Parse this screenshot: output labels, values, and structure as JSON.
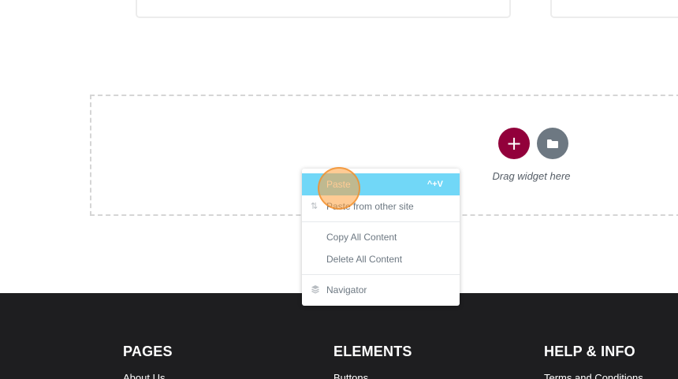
{
  "editor": {
    "drag_hint": "Drag widget here",
    "add_button_glyph": "+",
    "add_button_color": "#92003b",
    "folder_button_color": "#6d7882"
  },
  "context_menu": {
    "items": [
      {
        "label": "Paste",
        "shortcut": "^+V",
        "icon": "none",
        "active": true
      },
      {
        "label": "Paste from other site",
        "icon": "arrows-updown-icon"
      },
      {
        "label": "Copy All Content",
        "icon": "none"
      },
      {
        "label": "Delete All Content",
        "icon": "none"
      },
      {
        "label": "Navigator",
        "icon": "layers-icon"
      }
    ],
    "highlight_color": "#71d7f7"
  },
  "footer": {
    "background": "#1e1e20",
    "columns": [
      {
        "title": "PAGES",
        "first_link": "About Us"
      },
      {
        "title": "ELEMENTS",
        "first_link": "Buttons"
      },
      {
        "title": "HELP & INFO",
        "first_link": "Terms and Conditions"
      }
    ]
  }
}
